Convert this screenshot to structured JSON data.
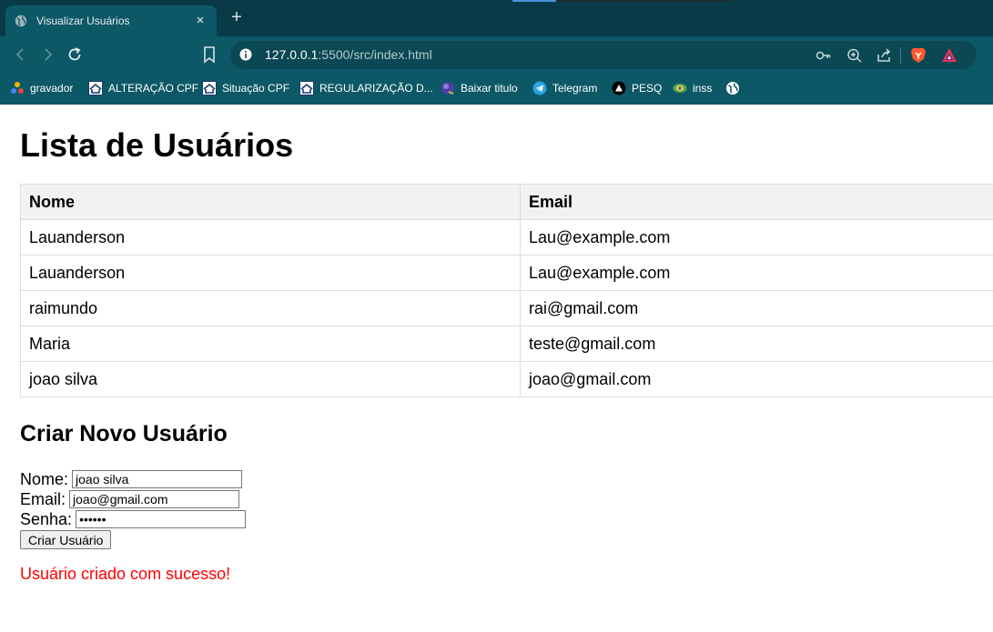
{
  "browser": {
    "tab_title": "Visualizar Usuários",
    "tab_close": "×",
    "new_tab": "+",
    "url_host": "127.0.0.1",
    "url_rest": ":5500/src/index.html",
    "icons": {
      "tab": "globe-icon",
      "back": "back-arrow-icon",
      "forward": "forward-arrow-icon",
      "reload": "reload-icon",
      "bookmark": "bookmark-icon",
      "info": "site-info-icon",
      "password": "key-icon",
      "zoom": "zoom-icon",
      "share": "share-icon",
      "brave": "brave-shield-icon",
      "rewards": "brave-rewards-icon"
    },
    "accent_color": "#4a90d9",
    "chrome_color": "#0d5866"
  },
  "bookmarks": [
    {
      "label": "gravador",
      "icon": "colored-dots-icon"
    },
    {
      "label": "ALTERAÇÃO CPF",
      "icon": "receita-federal-icon"
    },
    {
      "label": "Situação CPF",
      "icon": "receita-federal-icon"
    },
    {
      "label": "REGULARIZAÇÃO D...",
      "icon": "receita-federal-icon"
    },
    {
      "label": "Baixar titulo",
      "icon": "sphere-icon"
    },
    {
      "label": "Telegram",
      "icon": "telegram-icon"
    },
    {
      "label": "PESQ",
      "icon": "triangle-icon"
    },
    {
      "label": "inss",
      "icon": "inss-icon"
    },
    {
      "label": "",
      "icon": "globe-icon"
    }
  ],
  "page": {
    "title": "Lista de Usuários",
    "table": {
      "headers": [
        "Nome",
        "Email"
      ],
      "rows": [
        [
          "Lauanderson",
          "Lau@example.com"
        ],
        [
          "Lauanderson",
          "Lau@example.com"
        ],
        [
          "raimundo",
          "rai@gmail.com"
        ],
        [
          "Maria",
          "teste@gmail.com"
        ],
        [
          "joao silva",
          "joao@gmail.com"
        ]
      ]
    },
    "form": {
      "heading": "Criar Novo Usuário",
      "name_label": "Nome:",
      "name_value": "joao silva",
      "email_label": "Email:",
      "email_value": "joao@gmail.com",
      "password_label": "Senha:",
      "password_value": "123456",
      "submit_label": "Criar Usuário"
    },
    "message": "Usuário criado com sucesso!",
    "message_color": "#ff0000"
  }
}
